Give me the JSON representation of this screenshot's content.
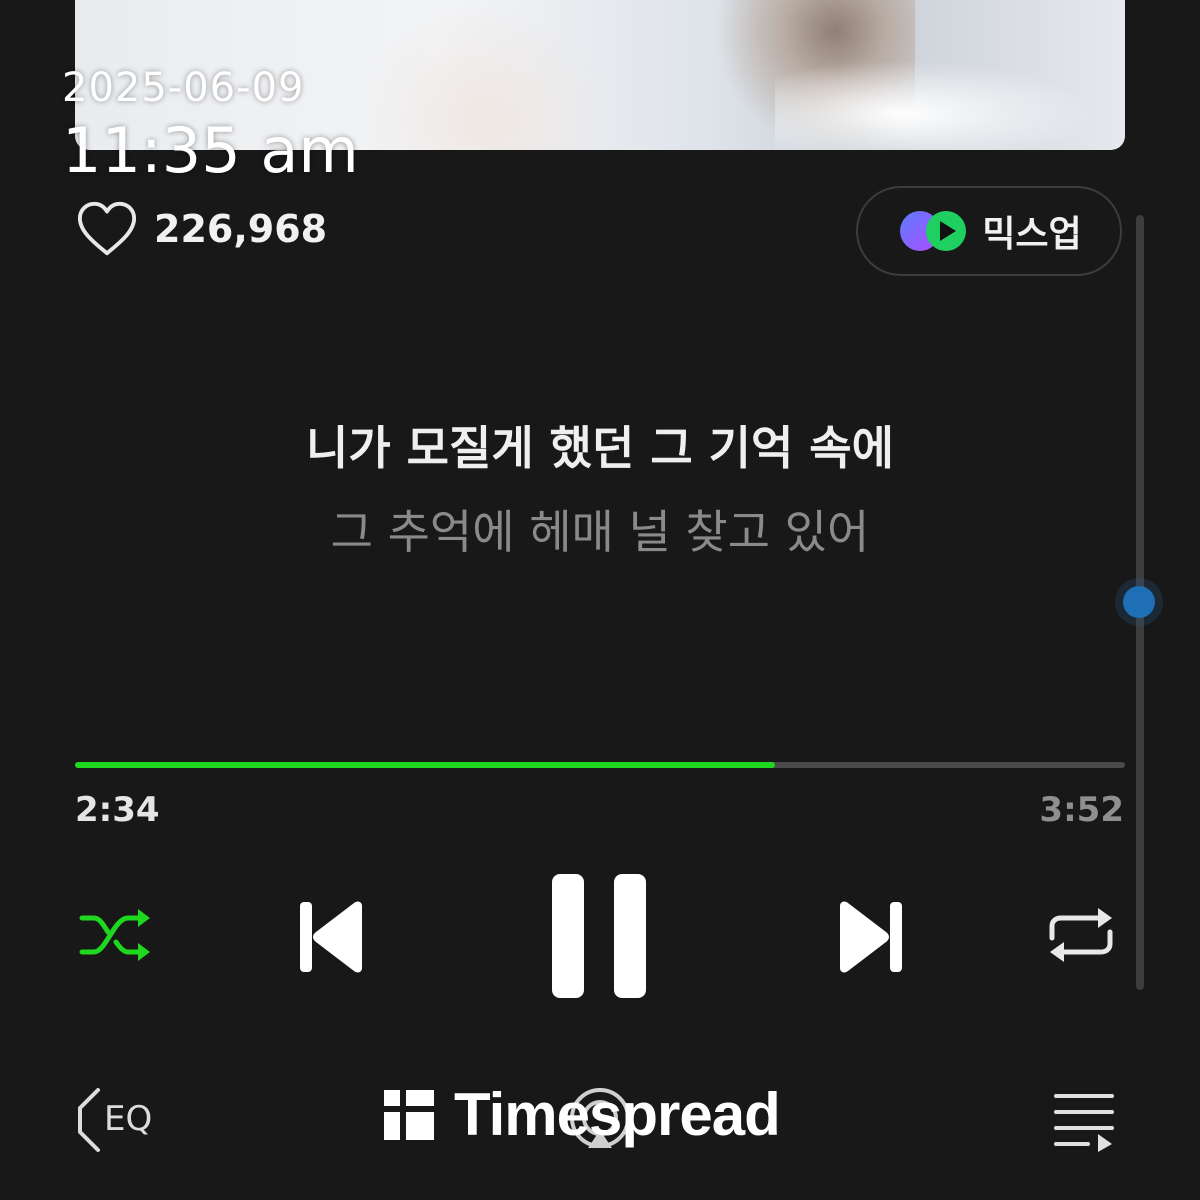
{
  "overlay": {
    "date": "2025-06-09",
    "time": "11:35 am"
  },
  "album": {
    "art_icon": "album-art-image"
  },
  "like": {
    "icon": "heart-outline-icon",
    "count": "226,968"
  },
  "mixup": {
    "icon": "mixup-logo-icon",
    "label": "믹스업"
  },
  "lyrics": {
    "current": "니가 모질게 했던 그 기억 속에",
    "next": "그 추억에 헤매 널 찾고 있어"
  },
  "playback": {
    "elapsed": "2:34",
    "duration": "3:52",
    "progress_fraction": 0.667,
    "colors": {
      "progress": "#1ed71e",
      "track": "#4a4a4a",
      "accent_shuffle": "#1ed71e"
    }
  },
  "controls": {
    "shuffle_icon": "shuffle-icon",
    "prev_icon": "skip-previous-icon",
    "pause_icon": "pause-icon",
    "next_icon": "skip-next-icon",
    "repeat_icon": "repeat-icon"
  },
  "bottom_bar": {
    "eq_label": "EQ",
    "eq_icon": "speaker-eq-icon",
    "cast_icon": "cast-icon",
    "playlist_icon": "playlist-icon"
  },
  "watermark": {
    "text": "Timespread"
  }
}
